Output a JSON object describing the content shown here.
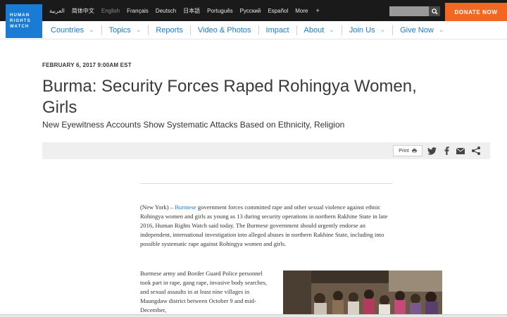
{
  "logo": {
    "lines": [
      "HUMAN",
      "RIGHTS",
      "WATCH"
    ]
  },
  "languages": [
    {
      "label": "العربية",
      "active": false
    },
    {
      "label": "简体中文",
      "active": false
    },
    {
      "label": "English",
      "active": true
    },
    {
      "label": "Français",
      "active": false
    },
    {
      "label": "Deutsch",
      "active": false
    },
    {
      "label": "日本語",
      "active": false
    },
    {
      "label": "Português",
      "active": false
    },
    {
      "label": "Русский",
      "active": false
    },
    {
      "label": "Español",
      "active": false
    },
    {
      "label": "More",
      "active": false
    }
  ],
  "more_caret": "+",
  "search": {
    "placeholder": "",
    "icon": "search-icon"
  },
  "donate_label": "DONATE NOW",
  "colors": {
    "brand_blue": "#1a7bd4",
    "donate_orange": "#f26722",
    "topbar": "#1a1a1a"
  },
  "nav": [
    {
      "label": "Countries",
      "dropdown": true
    },
    {
      "label": "Topics",
      "dropdown": true
    },
    {
      "label": "Reports",
      "dropdown": false
    },
    {
      "label": "Video & Photos",
      "dropdown": false
    },
    {
      "label": "Impact",
      "dropdown": false
    },
    {
      "label": "About",
      "dropdown": true
    },
    {
      "label": "Join Us",
      "dropdown": true
    },
    {
      "label": "Give Now",
      "dropdown": true
    }
  ],
  "article": {
    "dateline": "FEBRUARY 6, 2017 9:00AM EST",
    "headline_line1": "Burma: Security Forces Raped Rohingya Women,",
    "headline_line2": "Girls",
    "subtitle": "New Eyewitness Accounts Show Systematic Attacks Based on Ethnicity, Religion",
    "print_label": "Print",
    "share_icons": [
      "twitter-icon",
      "facebook-icon",
      "email-icon",
      "share-icon"
    ],
    "p1_prefix": "(New York) – ",
    "p1_link": "Burmese",
    "p1_rest": " government forces committed rape and other sexual violence against ethnic Rohingya women and girls as young as 13 during security operations in northern Rakhine State in late 2016, Human Rights Watch said today. The Burmese government should urgently endorse an independent, international investigation into alleged abuses in northern Rakhine State, including into possible systematic rape against Rohingya women and girls.",
    "p2": "Burmese army and Border Guard Police personnel took part in rape, gang rape, invasive body searches, and sexual assaults in at least nine villages in Maungdaw district between October 9 and mid-December,"
  }
}
